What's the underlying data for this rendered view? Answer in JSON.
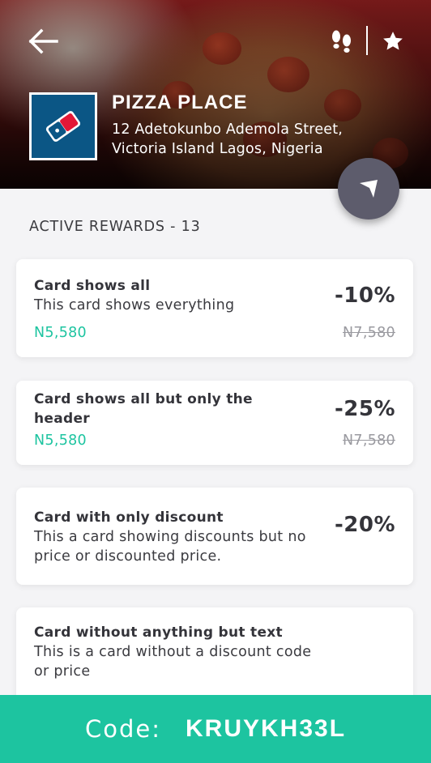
{
  "header": {
    "back_icon": "arrow-left-icon",
    "steps_icon": "footsteps-icon",
    "favorite_icon": "star-icon"
  },
  "store": {
    "name": "PIZZA PLACE",
    "address": "12 Adetokunbo Ademola Street, Victoria Island Lagos, Nigeria",
    "logo_color": "#0b5685",
    "directions_icon": "navigation-arrow-icon"
  },
  "rewards": {
    "title": "ACTIVE REWARDS - 13",
    "cards": [
      {
        "title": "Card shows all",
        "subtitle": "This card shows everything",
        "price": "N5,580",
        "discount": "-10%",
        "old_price": "N7,580"
      },
      {
        "title": "Card shows all but only the header",
        "price": "N5,580",
        "discount": "-25%",
        "old_price": "N7,580"
      },
      {
        "title": "Card with only discount",
        "subtitle": "This a card showing discounts but no price or discounted price.",
        "discount": "-20%"
      },
      {
        "title": "Card without anything but text",
        "subtitle": "This is a card without a discount code or price"
      }
    ]
  },
  "footer": {
    "code_label": "Code:",
    "code_value": "KRUYKH33L"
  },
  "colors": {
    "accent": "#1dc4a0",
    "fab": "#5d5c6c",
    "text_dark": "#34343a"
  }
}
